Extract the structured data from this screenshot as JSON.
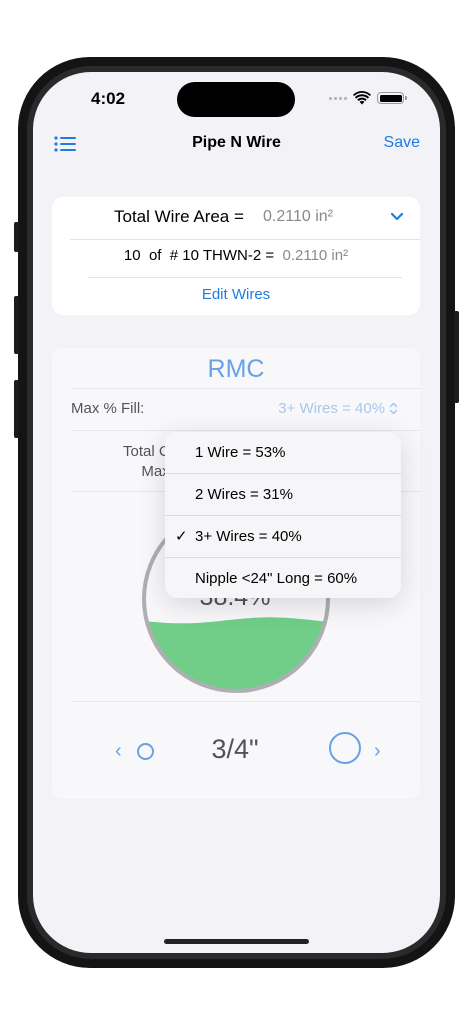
{
  "status_bar": {
    "time": "4:02"
  },
  "nav": {
    "title": "Pipe N Wire",
    "save_label": "Save",
    "menu_icon": "list-icon"
  },
  "wire_summary": {
    "total_label": "Total Wire Area =",
    "total_value": "0.2110 in²",
    "wire_count": "10",
    "wire_of": "of",
    "wire_spec": "# 10 THWN-2 =",
    "wire_area": "0.2110 in²",
    "edit_label": "Edit Wires"
  },
  "conduit": {
    "type": "RMC",
    "max_fill_label": "Max % Fill:",
    "max_fill_value": "3+ Wires = 40%",
    "total_line1": "Total C",
    "total_line2": "Max",
    "fill_percent": "38.4%",
    "fill_fraction": 0.384,
    "size": "3/4\""
  },
  "dropdown": {
    "options": [
      {
        "label": "1 Wire = 53%",
        "selected": false
      },
      {
        "label": "2 Wires = 31%",
        "selected": false
      },
      {
        "label": "3+ Wires = 40%",
        "selected": true
      },
      {
        "label": "Nipple <24\" Long = 60%",
        "selected": false
      }
    ],
    "check_mark": "✓"
  },
  "nav_controls": {
    "prev_chevron": "‹",
    "next_chevron": "›"
  },
  "colors": {
    "accent": "#1e7ce3",
    "fill_green": "#2fbf51",
    "ring": "#8e8e93"
  }
}
